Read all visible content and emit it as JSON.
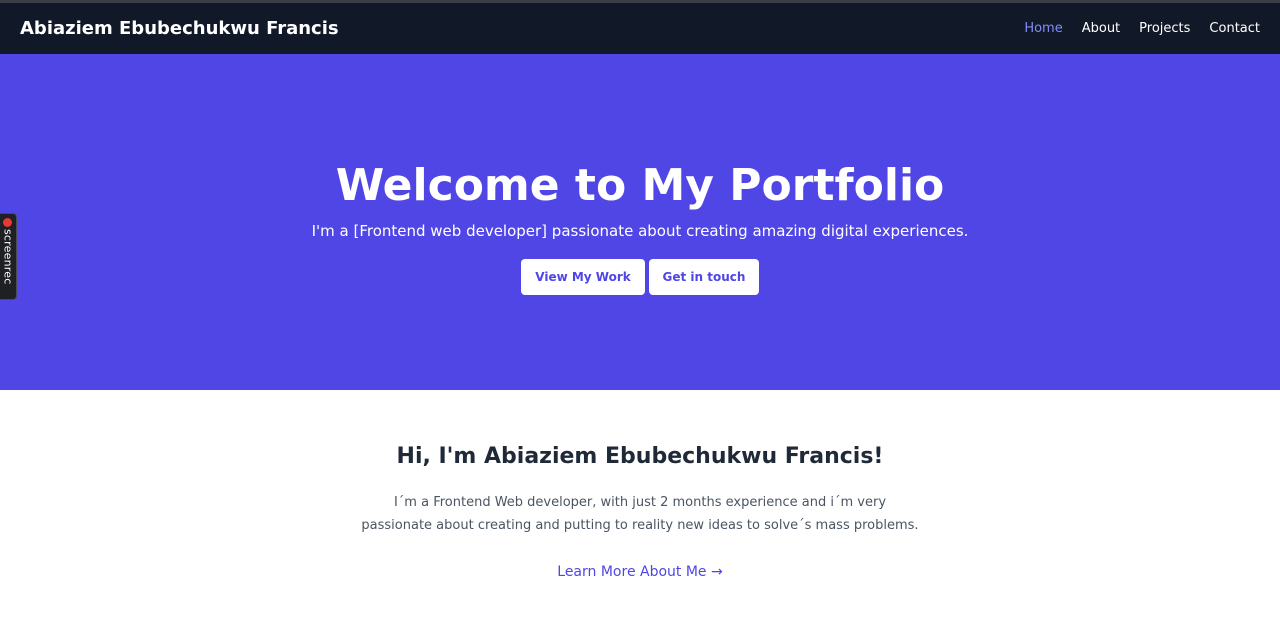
{
  "navbar": {
    "brand": "Abiaziem Ebubechukwu Francis",
    "links": [
      {
        "label": "Home",
        "active": true
      },
      {
        "label": "About",
        "active": false
      },
      {
        "label": "Projects",
        "active": false
      },
      {
        "label": "Contact",
        "active": false
      }
    ]
  },
  "hero": {
    "title": "Welcome to My Portfolio",
    "subtitle": "I'm a [Frontend web developer] passionate about creating amazing digital experiences.",
    "buttons": {
      "primary": "View My Work",
      "secondary": "Get in touch"
    }
  },
  "overlay": {
    "label": "screenrec"
  },
  "about": {
    "heading": "Hi, I'm Abiaziem Ebubechukwu Francis!",
    "text_lines": [
      "I´m a Frontend Web developer, with just 2 months experience and i´m very",
      "passionate about creating and putting to reality new ideas to solve´s mass problems."
    ],
    "link": "Learn More About Me →"
  },
  "colors": {
    "navbar_bg": "#111827",
    "hero_bg": "#4f46e5",
    "accent": "#4f46e5",
    "active_link": "#818cf8",
    "heading_text": "#1f2937",
    "body_text": "#4b5563"
  }
}
